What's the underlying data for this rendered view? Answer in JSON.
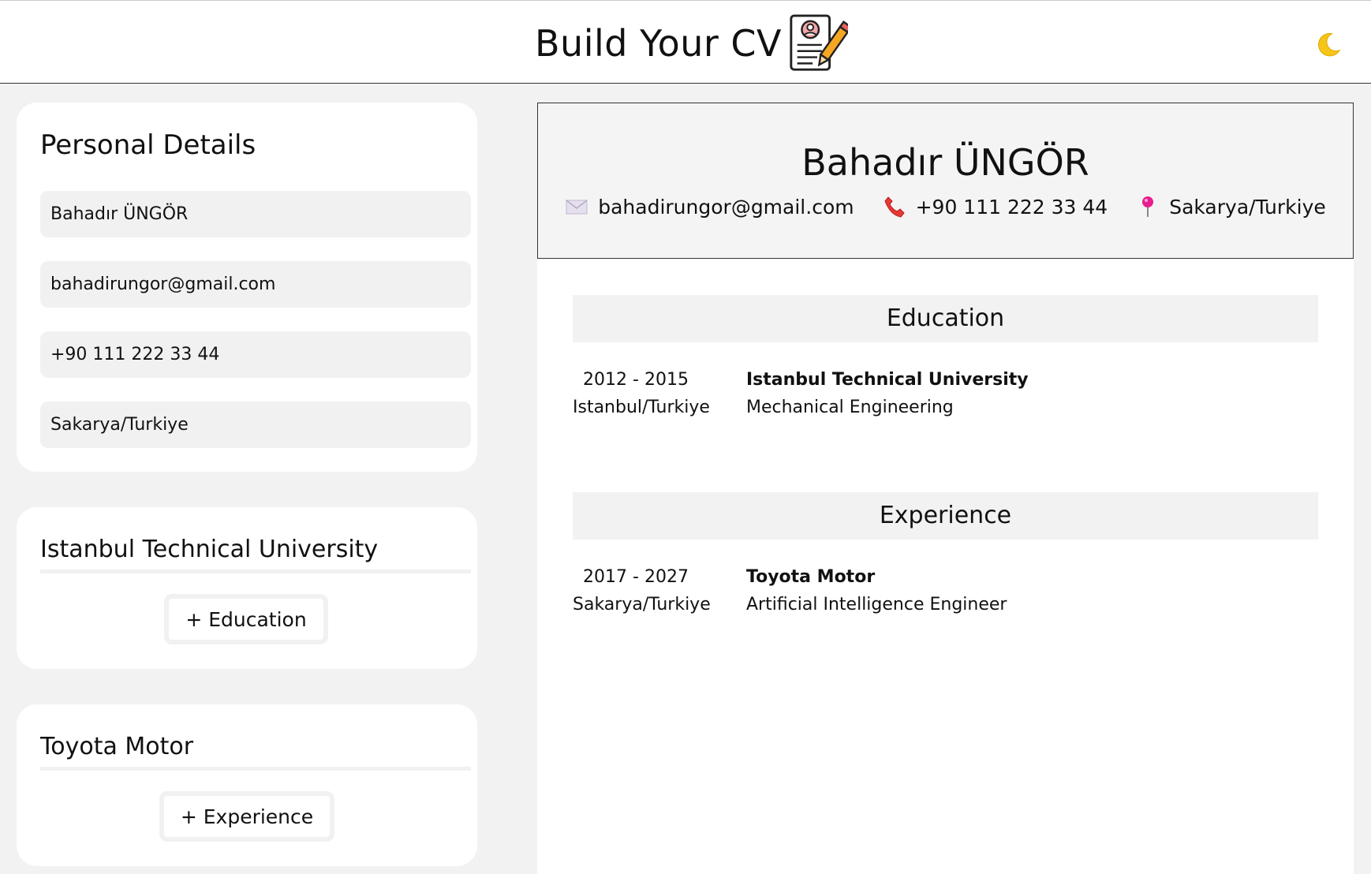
{
  "header": {
    "title": "Build Your CV",
    "brand_icon": "cv-document-pencil-icon",
    "theme_toggle_icon": "moon-icon"
  },
  "form": {
    "personal": {
      "title": "Personal Details",
      "name": "Bahadır ÜNGÖR",
      "email": "bahadirungor@gmail.com",
      "phone": "+90 111 222 33 44",
      "location": "Sakarya/Turkiye"
    },
    "education": {
      "entries": [
        "Istanbul Technical University"
      ],
      "add_label": "+ Education"
    },
    "experience": {
      "entries": [
        "Toyota Motor"
      ],
      "add_label": "+ Experience"
    }
  },
  "cv": {
    "name": "Bahadır ÜNGÖR",
    "email": "bahadirungor@gmail.com",
    "phone": "+90 111 222 33 44",
    "location": "Sakarya/Turkiye",
    "education": {
      "title": "Education",
      "items": [
        {
          "dates": "2012 - 2015",
          "place": "Istanbul/Turkiye",
          "org": "Istanbul Technical University",
          "role": "Mechanical Engineering"
        }
      ]
    },
    "experience": {
      "title": "Experience",
      "items": [
        {
          "dates": "2017 - 2027",
          "place": "Sakarya/Turkiye",
          "org": "Toyota Motor",
          "role": "Artificial Intelligence Engineer"
        }
      ]
    }
  },
  "colors": {
    "background": "#f2f2f2",
    "card": "#ffffff",
    "field": "#f1f1f1",
    "moon": "#f5c518",
    "phone_icon": "#e53935",
    "pin_icon": "#e91e8c"
  }
}
